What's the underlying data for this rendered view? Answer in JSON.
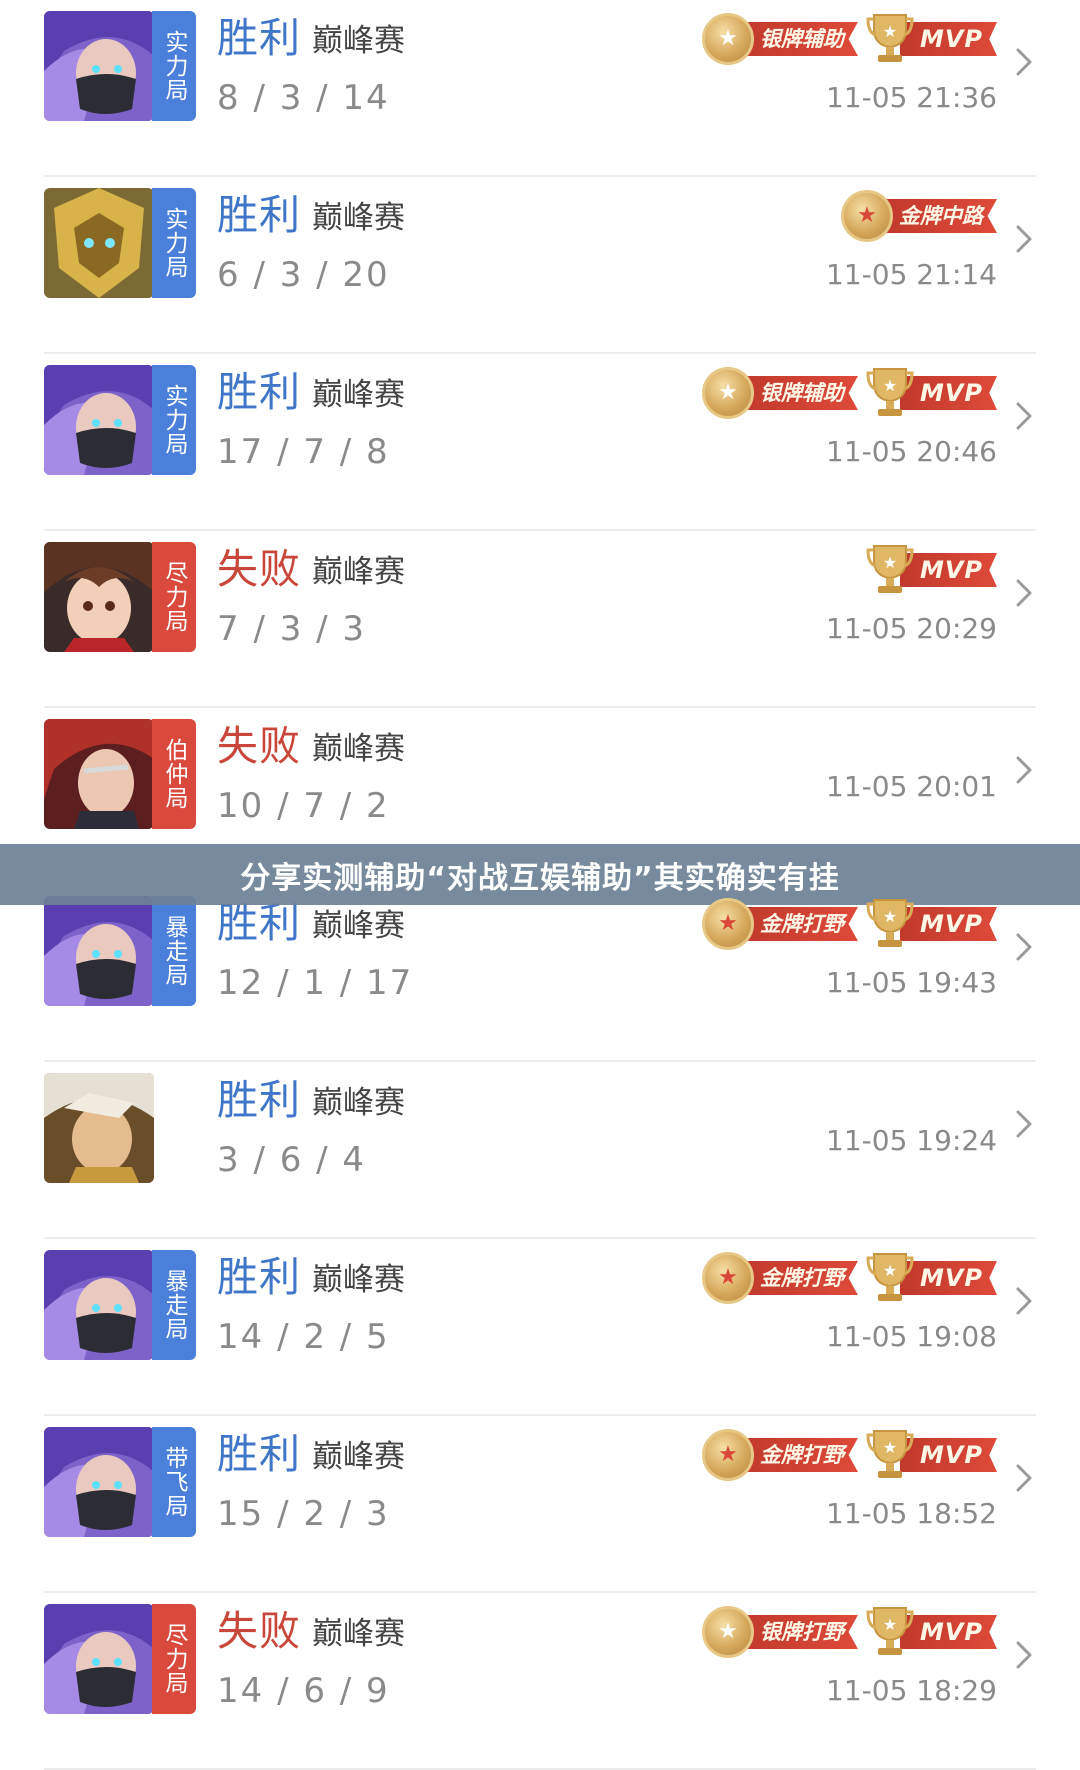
{
  "overlay": {
    "caption": "分享实测辅助“对战互娱辅助”其实确实有挂"
  },
  "matches": [
    {
      "result": "胜利",
      "result_type": "win",
      "mode": "巅峰赛",
      "kda": "8 / 3 / 14",
      "time": "11-05 21:36",
      "tag": "实力局",
      "tag_color": "blue",
      "avatar_icon": "purple-hair-masked-hero",
      "badges": [
        {
          "label": "银牌辅助",
          "kind": "silver"
        },
        {
          "label": "MVP",
          "kind": "mvp"
        }
      ]
    },
    {
      "result": "胜利",
      "result_type": "win",
      "mode": "巅峰赛",
      "kda": "6 / 3 / 20",
      "time": "11-05 21:14",
      "tag": "实力局",
      "tag_color": "blue",
      "avatar_icon": "golden-armored-hero",
      "badges": [
        {
          "label": "金牌中路",
          "kind": "gold"
        }
      ]
    },
    {
      "result": "胜利",
      "result_type": "win",
      "mode": "巅峰赛",
      "kda": "17 / 7 / 8",
      "time": "11-05 20:46",
      "tag": "实力局",
      "tag_color": "blue",
      "avatar_icon": "purple-hair-masked-hero",
      "badges": [
        {
          "label": "银牌辅助",
          "kind": "silver"
        },
        {
          "label": "MVP",
          "kind": "mvp"
        }
      ]
    },
    {
      "result": "失败",
      "result_type": "lose",
      "mode": "巅峰赛",
      "kda": "7 / 3 / 3",
      "time": "11-05 20:29",
      "tag": "尽力局",
      "tag_color": "red",
      "avatar_icon": "young-brown-hair-hero",
      "badges": [
        {
          "label": "MVP",
          "kind": "mvp"
        }
      ]
    },
    {
      "result": "失败",
      "result_type": "lose",
      "mode": "巅峰赛",
      "kda": "10 / 7 / 2",
      "time": "11-05 20:01",
      "tag": "伯仲局",
      "tag_color": "red",
      "avatar_icon": "red-hair-hero",
      "badges": []
    },
    {
      "result": "胜利",
      "result_type": "win",
      "mode": "巅峰赛",
      "kda": "12 / 1 / 17",
      "time": "11-05 19:43",
      "tag": "暴走局",
      "tag_color": "blue",
      "avatar_icon": "purple-hair-masked-hero",
      "badges": [
        {
          "label": "金牌打野",
          "kind": "gold"
        },
        {
          "label": "MVP",
          "kind": "mvp"
        }
      ]
    },
    {
      "result": "胜利",
      "result_type": "win",
      "mode": "巅峰赛",
      "kda": "3 / 6 / 4",
      "time": "11-05 19:24",
      "tag": "",
      "tag_color": "none",
      "avatar_icon": "white-hair-warrior-hero",
      "badges": []
    },
    {
      "result": "胜利",
      "result_type": "win",
      "mode": "巅峰赛",
      "kda": "14 / 2 / 5",
      "time": "11-05 19:08",
      "tag": "暴走局",
      "tag_color": "blue",
      "avatar_icon": "purple-hair-masked-hero",
      "badges": [
        {
          "label": "金牌打野",
          "kind": "gold"
        },
        {
          "label": "MVP",
          "kind": "mvp"
        }
      ]
    },
    {
      "result": "胜利",
      "result_type": "win",
      "mode": "巅峰赛",
      "kda": "15 / 2 / 3",
      "time": "11-05 18:52",
      "tag": "带飞局",
      "tag_color": "blue",
      "avatar_icon": "purple-hair-masked-hero",
      "badges": [
        {
          "label": "金牌打野",
          "kind": "gold"
        },
        {
          "label": "MVP",
          "kind": "mvp"
        }
      ]
    },
    {
      "result": "失败",
      "result_type": "lose",
      "mode": "巅峰赛",
      "kda": "14 / 6 / 9",
      "time": "11-05 18:29",
      "tag": "尽力局",
      "tag_color": "red",
      "avatar_icon": "purple-hair-masked-hero",
      "badges": [
        {
          "label": "银牌打野",
          "kind": "silver"
        },
        {
          "label": "MVP",
          "kind": "mvp"
        }
      ]
    }
  ],
  "colors": {
    "win": "#3f76c8",
    "lose": "#c8473a",
    "tag_blue": "#4a80d9",
    "tag_red": "#d94a3c",
    "badge_ribbon": "#c0392b",
    "badge_gold": "#d6a85b",
    "overlay_bar": "#6c8096"
  }
}
